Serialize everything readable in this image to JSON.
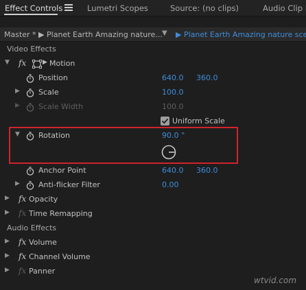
{
  "tabs": [
    {
      "label": "Effect Controls"
    },
    {
      "label": "Lumetri Scopes"
    },
    {
      "label": "Source: (no clips)"
    },
    {
      "label": "Audio Clip M"
    }
  ],
  "master": {
    "left": "Master * ▶ Planet Earth  Amazing nature...",
    "right": "▶ Planet Earth  Amazing nature scene"
  },
  "sections": {
    "video_effects": "Video Effects",
    "audio_effects": "Audio Effects"
  },
  "motion": {
    "fx": "fx",
    "label": "Motion",
    "position": {
      "label": "Position",
      "x": "640.0",
      "y": "360.0"
    },
    "scale": {
      "label": "Scale",
      "value": "100.0"
    },
    "scale_width": {
      "label": "Scale Width",
      "value": "100.0"
    },
    "uniform_scale": {
      "label": "Uniform Scale",
      "checked": true
    },
    "rotation": {
      "label": "Rotation",
      "value": "90.0 °"
    },
    "anchor_point": {
      "label": "Anchor Point",
      "x": "640.0",
      "y": "360.0"
    },
    "anti_flicker": {
      "label": "Anti-flicker Filter",
      "value": "0.00"
    }
  },
  "video_items": [
    {
      "fx": "fx",
      "label": "Opacity"
    },
    {
      "fx": "fx",
      "label": "Time Remapping"
    }
  ],
  "audio_items": [
    {
      "fx": "fx",
      "label": "Volume"
    },
    {
      "fx": "fx",
      "label": "Channel Volume"
    },
    {
      "fx": "fx",
      "label": "Panner"
    }
  ],
  "watermark": "wtvid.com",
  "colors": {
    "accent_value": "#3e8ddb",
    "highlight_box": "#d2232a",
    "background": "#1e1e1e"
  },
  "icons": [
    "menu-icon",
    "stopwatch-icon",
    "transform-icon",
    "chevron-right-icon",
    "chevron-down-icon",
    "rotation-dial-icon",
    "checkbox-check-icon"
  ]
}
